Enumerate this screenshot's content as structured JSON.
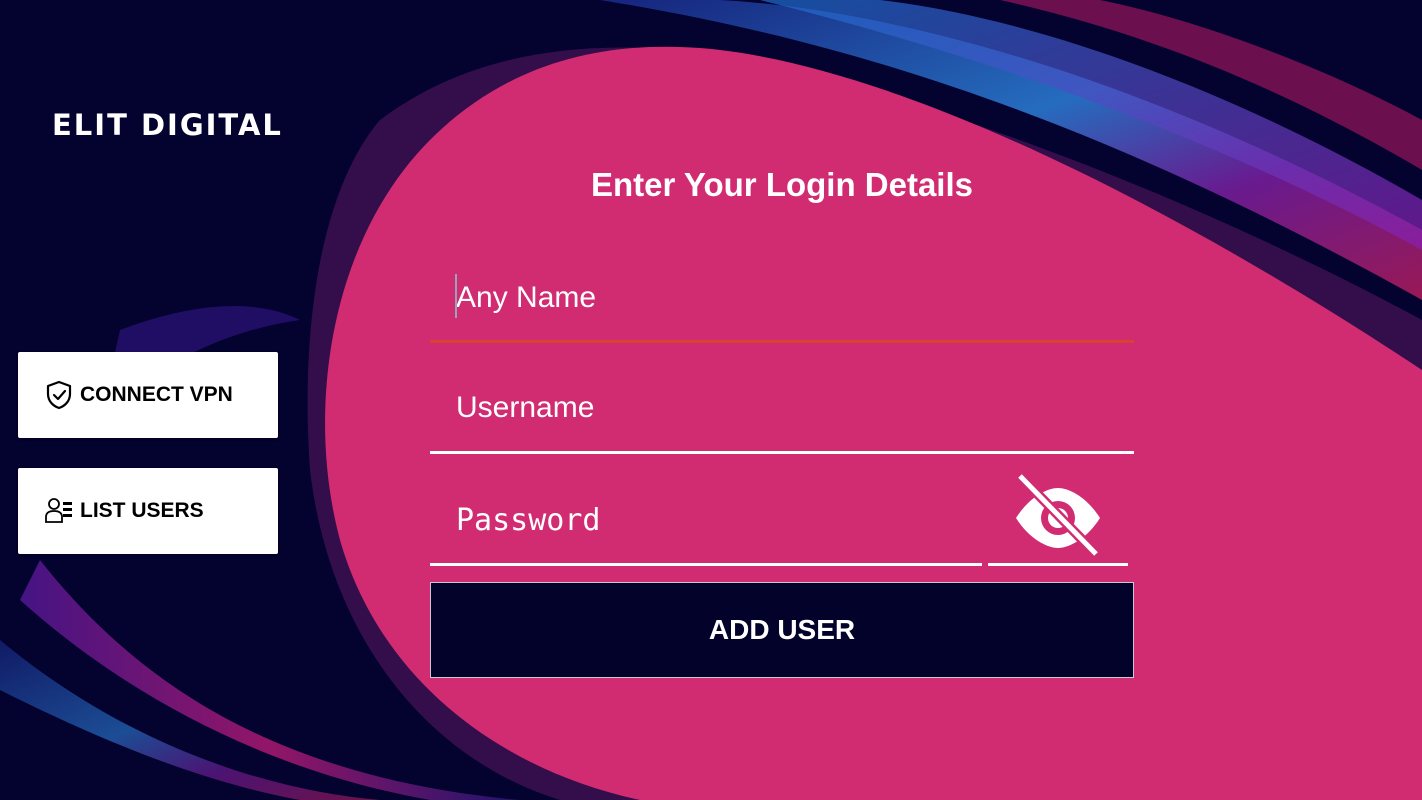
{
  "brand": {
    "title": "ELIT DIGITAL"
  },
  "sidebar": {
    "connect_vpn": {
      "label": "CONNECT VPN",
      "icon": "shield-check-icon"
    },
    "list_users": {
      "label": "LIST USERS",
      "icon": "user-list-icon"
    }
  },
  "form": {
    "title": "Enter Your Login Details",
    "name": {
      "placeholder": "Any Name",
      "value": ""
    },
    "username": {
      "placeholder": "Username",
      "value": ""
    },
    "password": {
      "placeholder": "Password",
      "value": "",
      "visibility_icon": "eye-slash-icon"
    },
    "submit_label": "ADD USER"
  },
  "colors": {
    "background": "#04022f",
    "panel": "#d12c72",
    "active_underline": "#d6432f",
    "button_bg": "#03022a",
    "text": "#ffffff"
  }
}
